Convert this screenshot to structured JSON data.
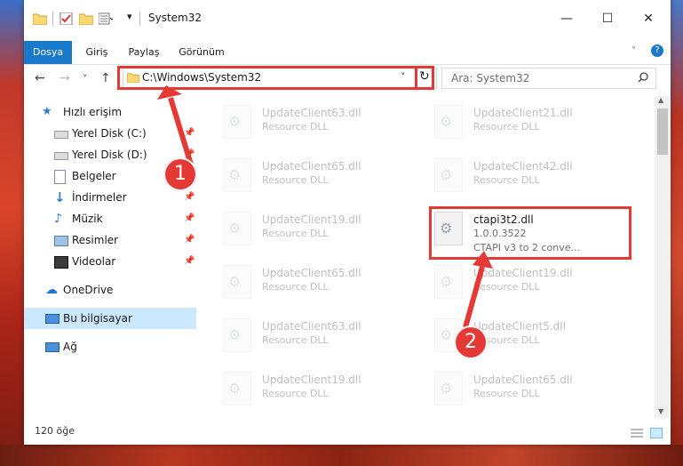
{
  "window": {
    "title": "System32",
    "minimize": "—",
    "maximize": "☐",
    "close": "✕",
    "help": "?"
  },
  "ribbon": {
    "tabs": [
      {
        "label": "Dosya",
        "active": true
      },
      {
        "label": "Giriş"
      },
      {
        "label": "Paylaş"
      },
      {
        "label": "Görünüm"
      }
    ]
  },
  "nav": {
    "back": "←",
    "forward": "→",
    "recent": "˅",
    "up": "↑",
    "address": "C:\\Windows\\System32",
    "refresh": "↻",
    "search_placeholder": "Ara: System32"
  },
  "sidebar": {
    "items": [
      {
        "label": "Hızlı erişim",
        "icon": "star-icon",
        "pinned": false
      },
      {
        "label": "Yerel Disk (C:)",
        "icon": "drive-icon",
        "pinned": true
      },
      {
        "label": "Yerel Disk (D:)",
        "icon": "drive-icon",
        "pinned": true
      },
      {
        "label": "Belgeler",
        "icon": "documents-icon",
        "pinned": true
      },
      {
        "label": "İndirmeler",
        "icon": "download-icon",
        "pinned": true
      },
      {
        "label": "Müzik",
        "icon": "music-icon",
        "pinned": true
      },
      {
        "label": "Resimler",
        "icon": "pictures-icon",
        "pinned": true
      },
      {
        "label": "Videolar",
        "icon": "videos-icon",
        "pinned": true
      },
      {
        "label": "OneDrive",
        "icon": "cloud-icon",
        "pinned": false
      },
      {
        "label": "Bu bilgisayar",
        "icon": "computer-icon",
        "pinned": false,
        "selected": true
      },
      {
        "label": "Ağ",
        "icon": "network-icon",
        "pinned": false
      }
    ]
  },
  "files": [
    {
      "name": "UpdateClient63.dll",
      "l2": "Resource DLL",
      "l3": ""
    },
    {
      "name": "UpdateClient21.dll",
      "l2": "Resource DLL",
      "l3": ""
    },
    {
      "name": "UpdateClient65.dll",
      "l2": "Resource DLL",
      "l3": ""
    },
    {
      "name": "UpdateClient42.dll",
      "l2": "Resource DLL",
      "l3": ""
    },
    {
      "name": "UpdateClient19.dll",
      "l2": "Resource DLL",
      "l3": ""
    },
    {
      "name": "ctapi3t2.dll",
      "l2": "1.0.0.3522",
      "l3": "CTAPI v3 to 2 conve...",
      "highlight": true
    },
    {
      "name": "UpdateClient65.dll",
      "l2": "Resource DLL",
      "l3": ""
    },
    {
      "name": "UpdateClient19.dll",
      "l2": "Resource DLL",
      "l3": ""
    },
    {
      "name": "UpdateClient63.dll",
      "l2": "Resource DLL",
      "l3": ""
    },
    {
      "name": "UpdateClient5.dll",
      "l2": "Resource DLL",
      "l3": ""
    },
    {
      "name": "UpdateClient19.dll",
      "l2": "Resource DLL",
      "l3": ""
    },
    {
      "name": "UpdateClient65.dll",
      "l2": "Resource DLL",
      "l3": ""
    }
  ],
  "status": {
    "count": "120 öğe"
  },
  "annotations": {
    "badge1": "1",
    "badge2": "2",
    "color": "#e53935"
  }
}
